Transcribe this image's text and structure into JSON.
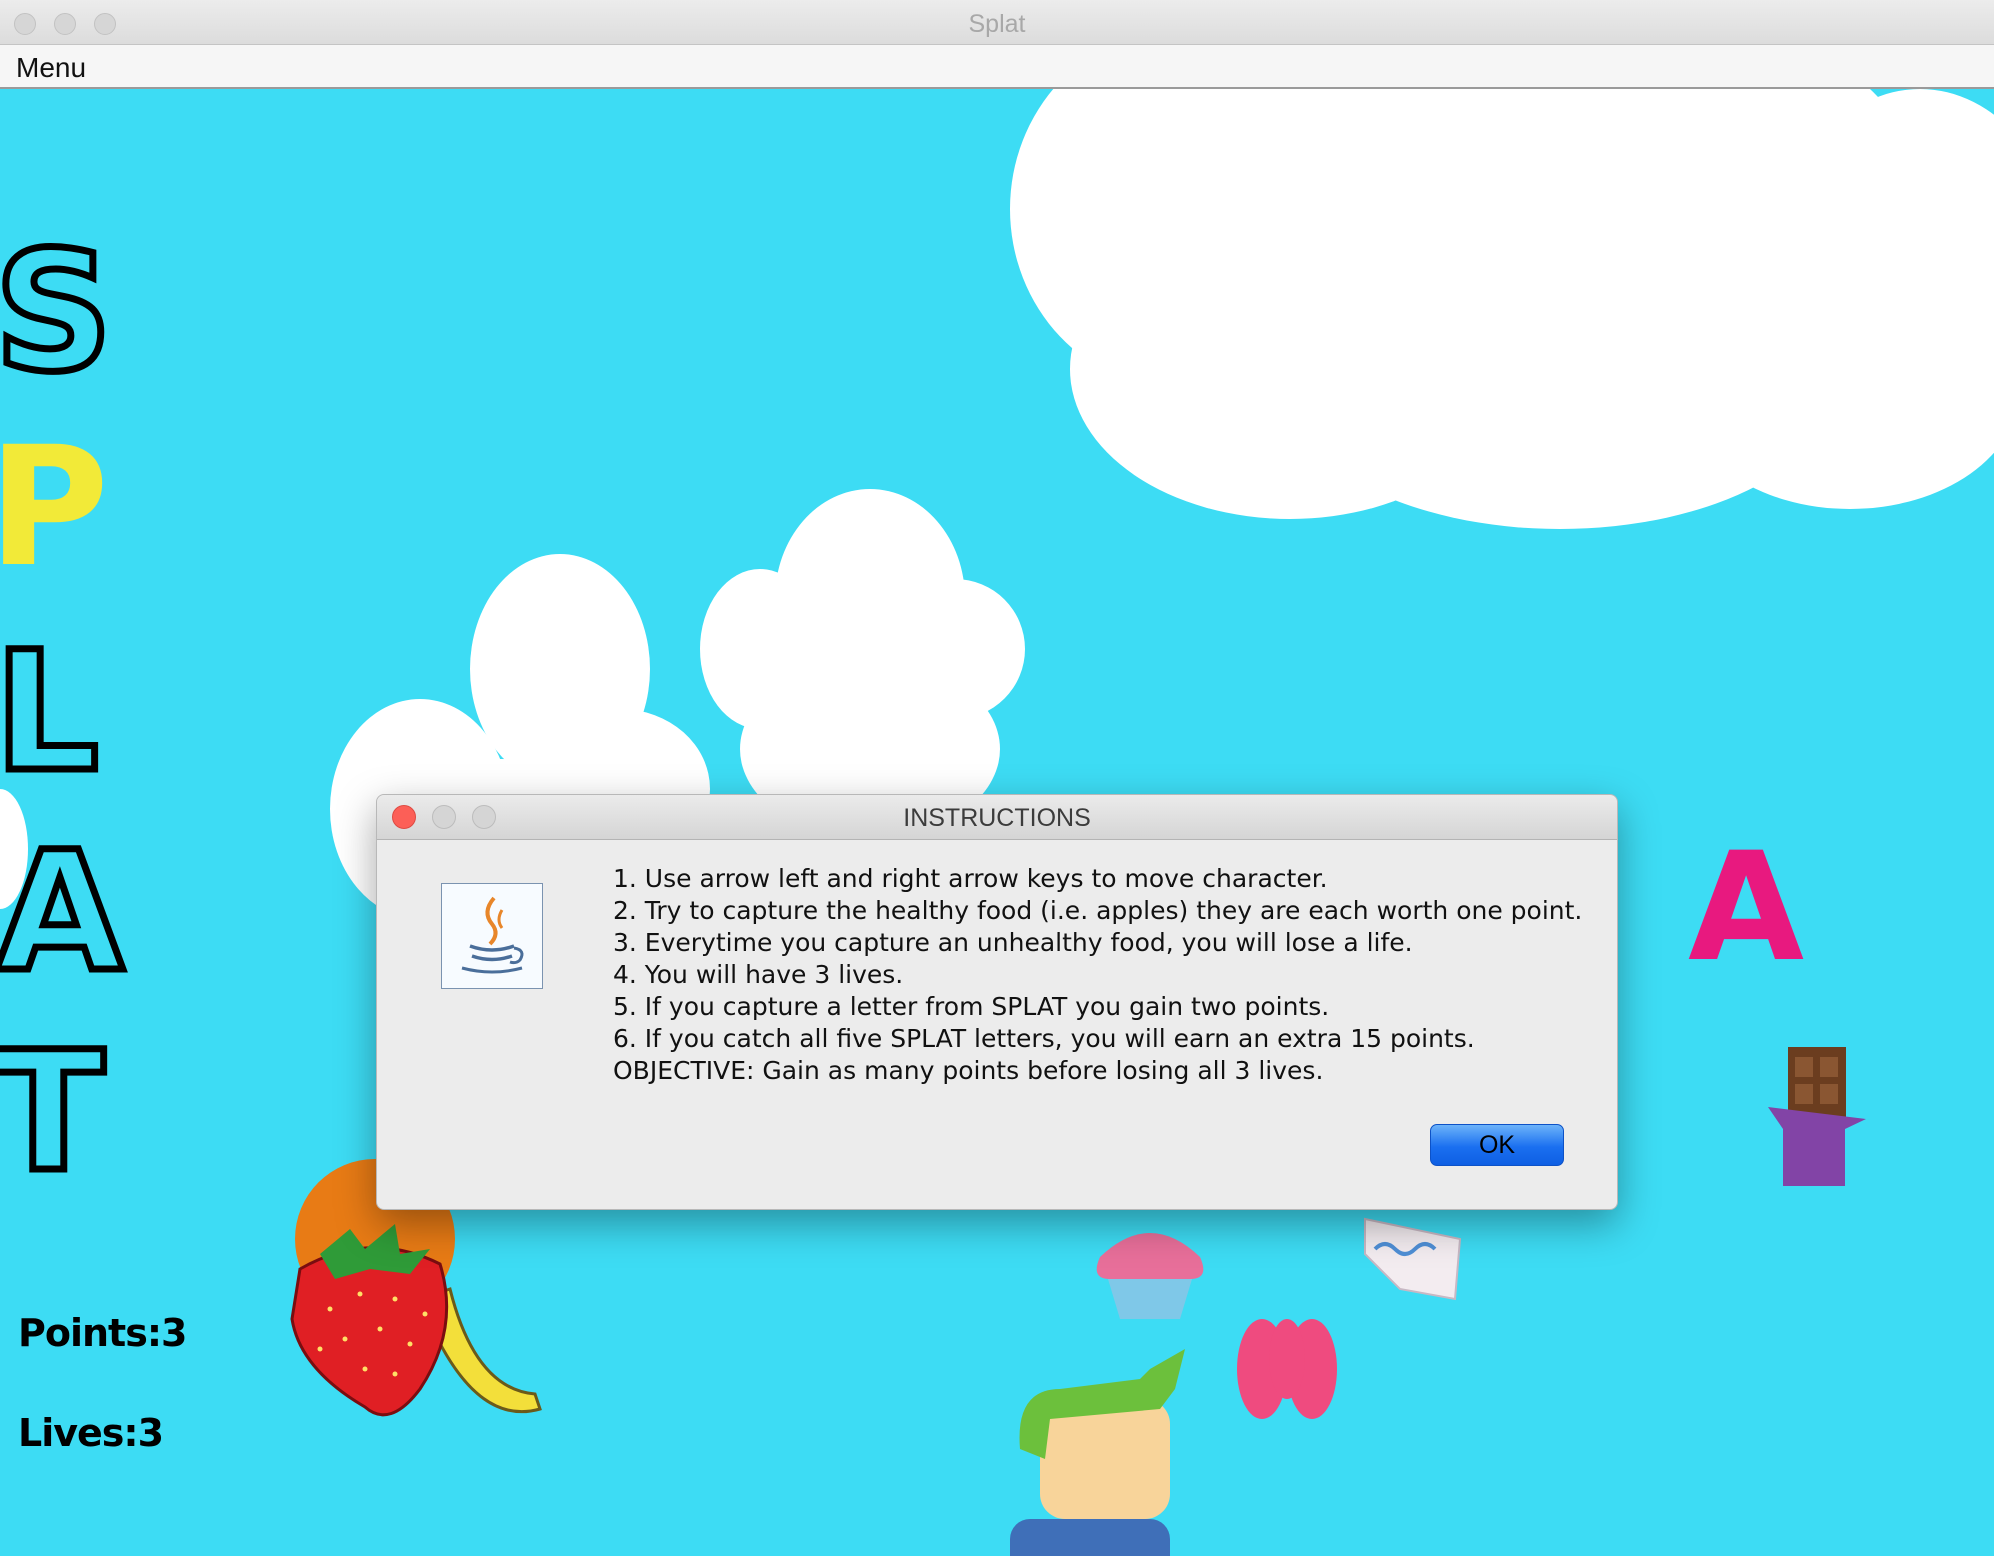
{
  "window": {
    "title": "Splat"
  },
  "menubar": {
    "menu_label": "Menu"
  },
  "hud": {
    "points": "Points:3",
    "lives": "Lives:3"
  },
  "splat_letters": [
    "S",
    "P",
    "L",
    "A",
    "T"
  ],
  "falling_letter": "A",
  "colors": {
    "sky": "#3ddcf4",
    "cloud": "#ffffff",
    "letter_p": "#f2ea38",
    "letter_falling": "#e8197f",
    "ok_button": "#1a6ff0"
  },
  "dialog": {
    "title": "INSTRUCTIONS",
    "icon": "java-cup-icon",
    "lines": [
      "1. Use arrow left and right arrow keys to move character.",
      "2. Try to capture the healthy food (i.e. apples) they are each worth one point.",
      "3. Everytime you capture an unhealthy food, you will lose a life.",
      "4. You will have 3 lives.",
      "5. If you capture a letter from SPLAT you gain two points.",
      "6. If you catch all five SPLAT letters, you will earn an extra 15 points.",
      "OBJECTIVE: Gain as many points before losing all 3 lives."
    ],
    "ok_label": "OK"
  }
}
